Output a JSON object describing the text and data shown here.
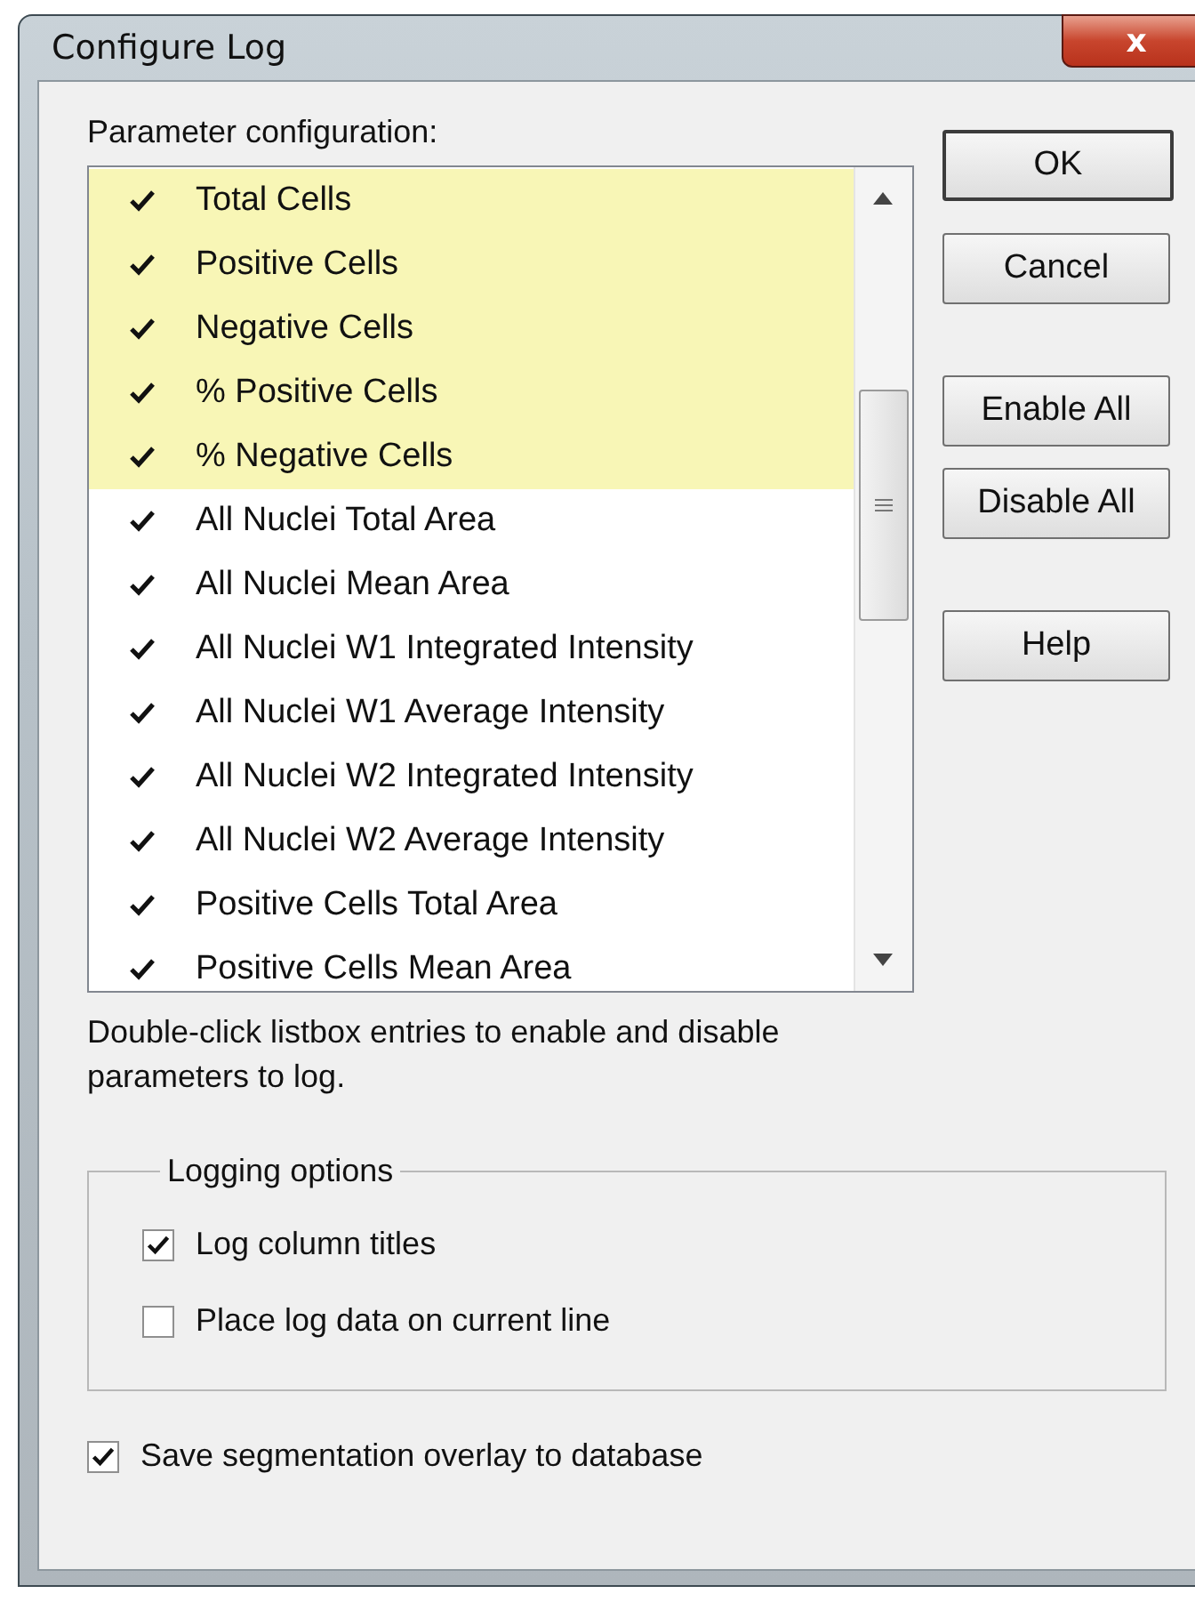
{
  "window": {
    "title": "Configure Log",
    "close": "x"
  },
  "parameters": {
    "label": "Parameter configuration:",
    "items": [
      {
        "name": "Total Cells",
        "checked": true,
        "selected": true
      },
      {
        "name": "Positive Cells",
        "checked": true,
        "selected": true
      },
      {
        "name": "Negative Cells",
        "checked": true,
        "selected": true
      },
      {
        "name": "% Positive Cells",
        "checked": true,
        "selected": true
      },
      {
        "name": "% Negative Cells",
        "checked": true,
        "selected": true
      },
      {
        "name": "All Nuclei Total Area",
        "checked": true,
        "selected": false
      },
      {
        "name": "All Nuclei Mean Area",
        "checked": true,
        "selected": false
      },
      {
        "name": "All Nuclei W1 Integrated Intensity",
        "checked": true,
        "selected": false
      },
      {
        "name": "All Nuclei W1 Average Intensity",
        "checked": true,
        "selected": false
      },
      {
        "name": "All Nuclei W2 Integrated Intensity",
        "checked": true,
        "selected": false
      },
      {
        "name": "All Nuclei W2 Average Intensity",
        "checked": true,
        "selected": false
      },
      {
        "name": "Positive Cells Total Area",
        "checked": true,
        "selected": false
      },
      {
        "name": "Positive Cells Mean Area",
        "checked": true,
        "selected": false
      }
    ],
    "hint": "Double-click listbox entries to enable and disable parameters to log."
  },
  "buttons": [
    {
      "label": "OK",
      "default": true
    },
    {
      "label": "Cancel",
      "default": false
    },
    {
      "label": "Enable All",
      "default": false
    },
    {
      "label": "Disable All",
      "default": false
    },
    {
      "label": "Help",
      "default": false
    }
  ],
  "logging_options": {
    "title": "Logging options",
    "options": [
      {
        "label": "Log column titles",
        "checked": true
      },
      {
        "label": "Place log data on current line",
        "checked": false
      }
    ]
  },
  "save_overlay": {
    "label": "Save segmentation overlay to database",
    "checked": true
  }
}
